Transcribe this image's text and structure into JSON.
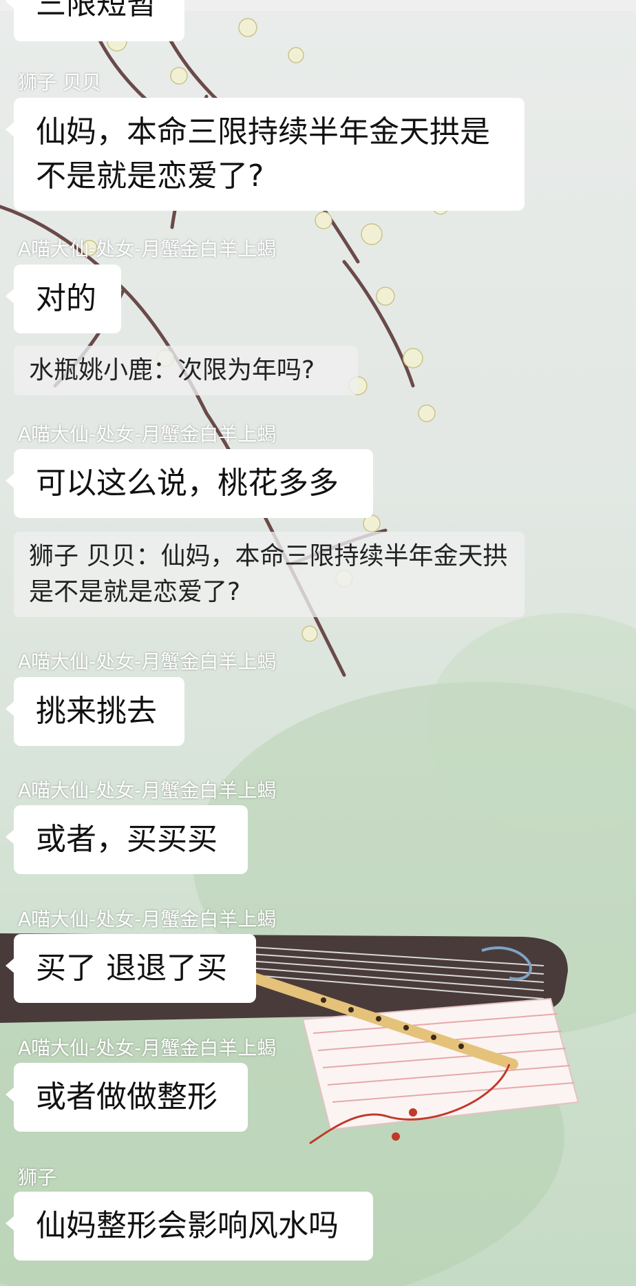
{
  "messages": [
    {
      "type": "bubble",
      "text": "三限短暂"
    },
    {
      "type": "name",
      "text": "狮子 贝贝"
    },
    {
      "type": "bubble",
      "text": "仙妈，本命三限持续半年金天拱是不是就是恋爱了?"
    },
    {
      "type": "name",
      "text": "A喵大仙-处女-月蟹金白羊上蝎"
    },
    {
      "type": "bubble",
      "text": "对的"
    },
    {
      "type": "quote",
      "text": "水瓶姚小鹿：次限为年吗?"
    },
    {
      "type": "name",
      "text": "A喵大仙-处女-月蟹金白羊上蝎"
    },
    {
      "type": "bubble",
      "text": "可以这么说，桃花多多"
    },
    {
      "type": "quote",
      "text": "狮子 贝贝：仙妈，本命三限持续半年金天拱是不是就是恋爱了?"
    },
    {
      "type": "name",
      "text": "A喵大仙-处女-月蟹金白羊上蝎"
    },
    {
      "type": "bubble",
      "text": "挑来挑去"
    },
    {
      "type": "name",
      "text": "A喵大仙-处女-月蟹金白羊上蝎"
    },
    {
      "type": "bubble",
      "text": "或者，买买买"
    },
    {
      "type": "name",
      "text": "A喵大仙-处女-月蟹金白羊上蝎"
    },
    {
      "type": "bubble",
      "text": "买了 退退了买"
    },
    {
      "type": "name",
      "text": "A喵大仙-处女-月蟹金白羊上蝎"
    },
    {
      "type": "bubble",
      "text": "或者做做整形"
    },
    {
      "type": "name",
      "text": "狮子"
    },
    {
      "type": "bubble",
      "text": "仙妈整形会影响风水吗"
    }
  ],
  "colors": {
    "bubble": "#ffffff",
    "name": "#ffffff",
    "text": "#111111"
  }
}
